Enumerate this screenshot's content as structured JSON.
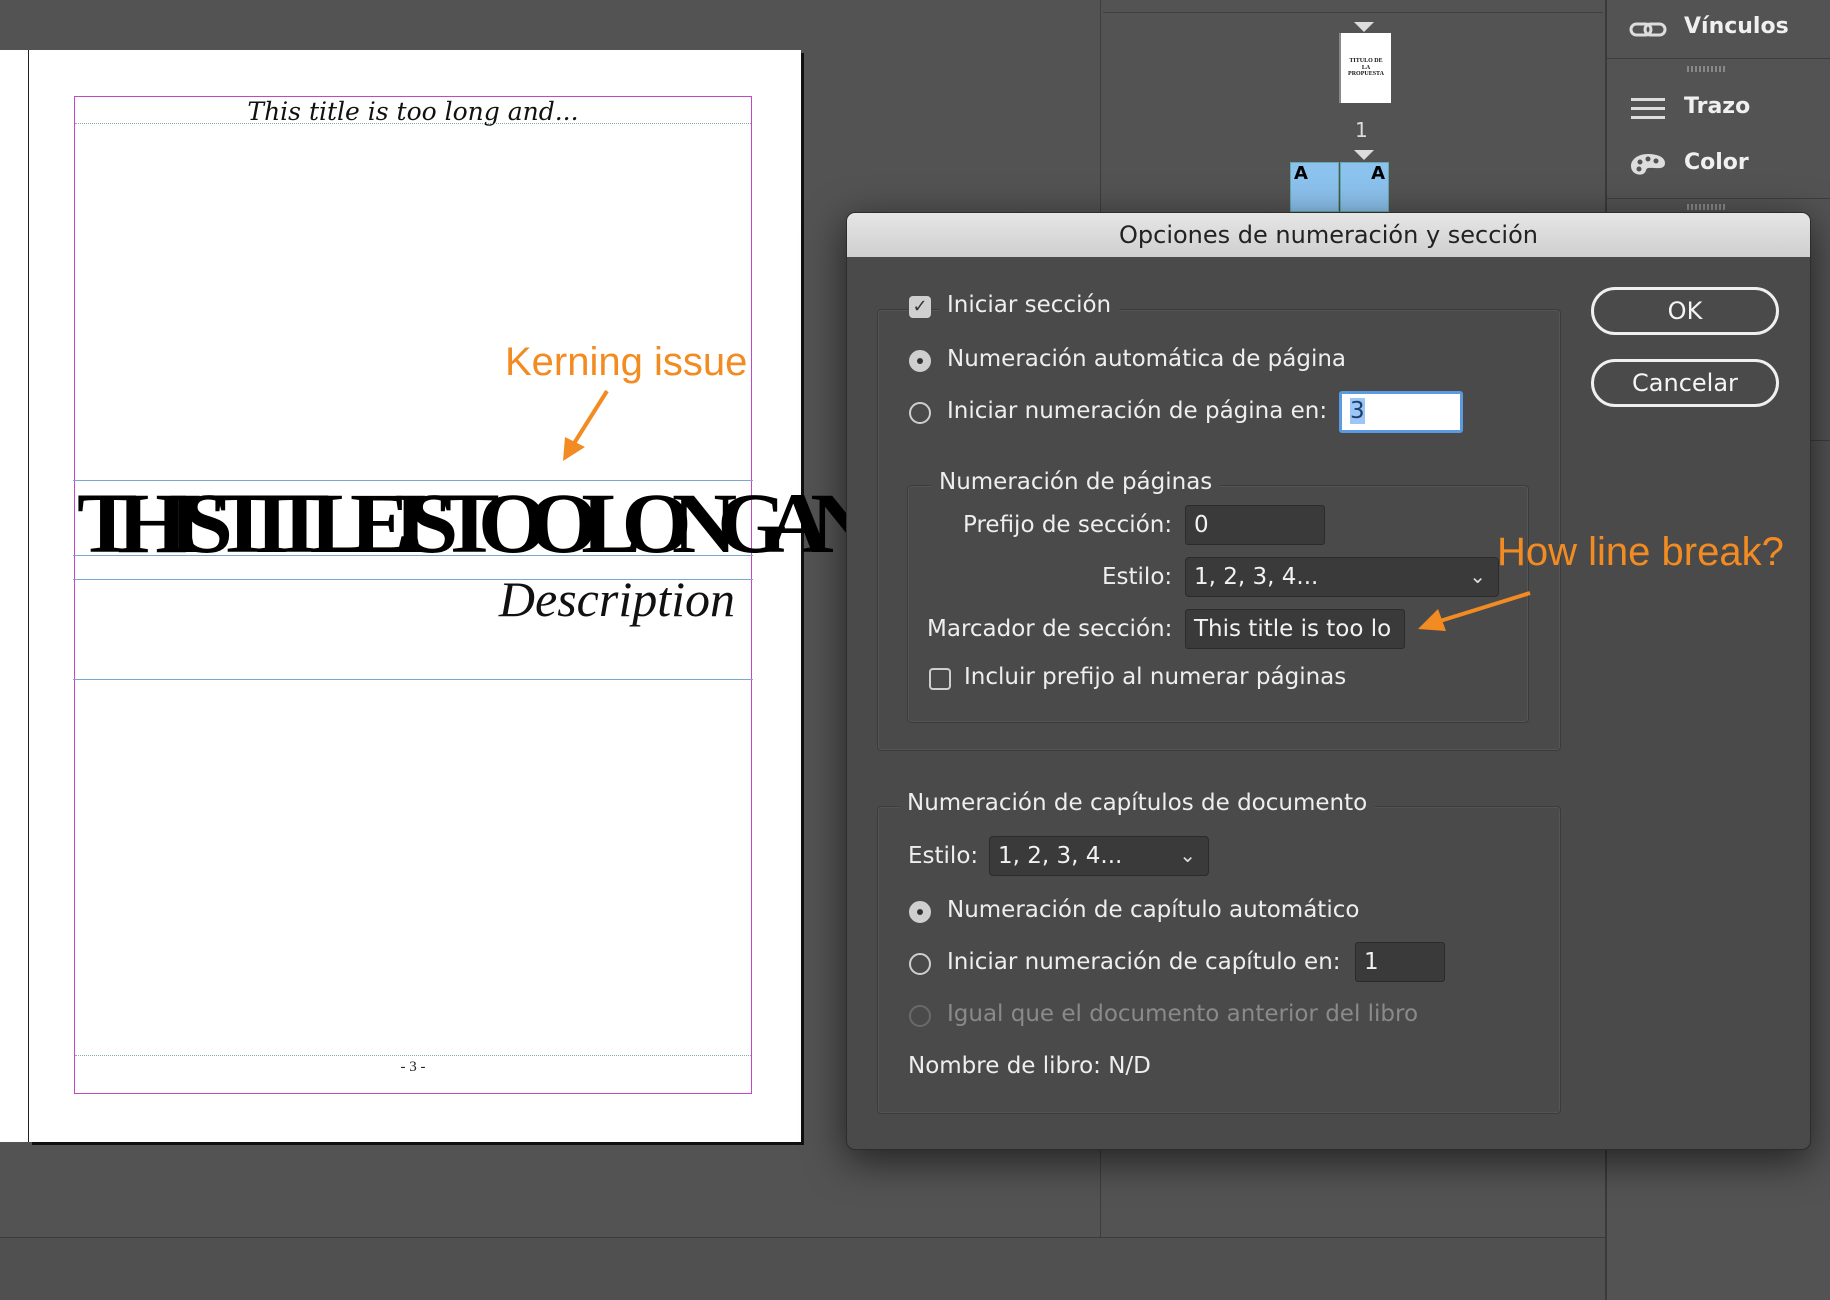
{
  "document": {
    "running_head": "This title is too long and...",
    "big_title": "THIS TITLE IS TOO LONG AND...",
    "description": "Description",
    "folio": "- 3 -"
  },
  "annotations": {
    "kerning": "Kerning issue",
    "line_break": "How line break?"
  },
  "pages_panel": {
    "page1_label": "1",
    "page1_thumb_text": "TITULO DE LA PROPUESTA",
    "master_letter_left": "A",
    "master_letter_right": "A"
  },
  "dock": {
    "items": [
      {
        "label": "Vínculos",
        "icon": "chain-link-icon"
      },
      {
        "label": "Trazo",
        "icon": "stroke-lines-icon"
      },
      {
        "label": "Color",
        "icon": "palette-icon"
      }
    ]
  },
  "dialog": {
    "title": "Opciones de numeración y sección",
    "ok_label": "OK",
    "cancel_label": "Cancelar",
    "section": {
      "start_section_label": "Iniciar sección",
      "start_section_checked": true,
      "auto_numbering_label": "Numeración automática de página",
      "start_at_label": "Iniciar numeración de página en:",
      "start_at_value": "3",
      "selected_option": "auto"
    },
    "page_numbering": {
      "group_title": "Numeración de páginas",
      "prefix_label": "Prefijo de sección:",
      "prefix_value": "0",
      "style_label": "Estilo:",
      "style_value": "1, 2, 3, 4...",
      "marker_label": "Marcador de sección:",
      "marker_value": "This title is too lo",
      "include_prefix_label": "Incluir prefijo al numerar páginas",
      "include_prefix_checked": false
    },
    "chapter_numbering": {
      "group_title": "Numeración de capítulos de documento",
      "style_label": "Estilo:",
      "style_value": "1, 2, 3, 4...",
      "auto_label": "Numeración de capítulo automático",
      "start_at_label": "Iniciar numeración de capítulo en:",
      "start_at_value": "1",
      "same_as_previous_label": "Igual que el documento anterior del libro",
      "book_name_label": "Nombre de libro: N/D",
      "selected_option": "auto"
    }
  },
  "colors": {
    "annotation": "#f28c22",
    "margin_guide": "#c04ac4",
    "baseline_guide": "#7aa7cf",
    "focus_ring": "#5b9ae0"
  }
}
